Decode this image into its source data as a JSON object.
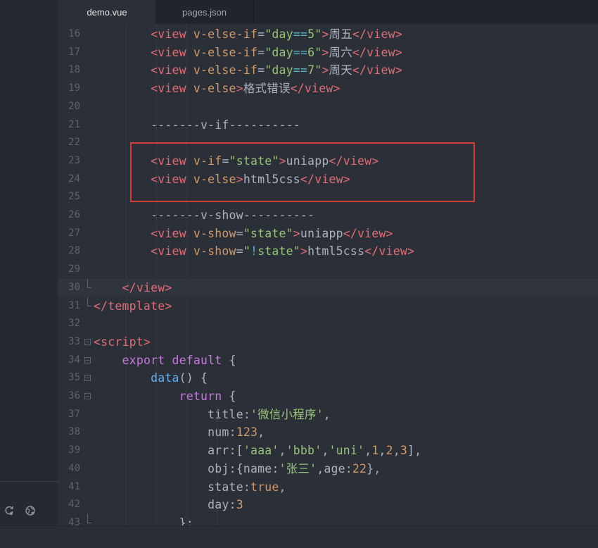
{
  "tabs": [
    {
      "label": "demo.vue",
      "active": true
    },
    {
      "label": "pages.json",
      "active": false
    }
  ],
  "colors": {
    "tag": "#e06c75",
    "attribute": "#d19a66",
    "string": "#98c379",
    "keyword": "#c678dd",
    "function": "#61afef",
    "highlight_box": "#d43c36"
  },
  "sidebar": {
    "icons": [
      "refresh-icon",
      "globe-icon"
    ]
  },
  "editor": {
    "lines": [
      {
        "n": "16",
        "indent": "        ",
        "tokens": [
          [
            "tag",
            "<view "
          ],
          [
            "attr",
            "v-else-if"
          ],
          [
            "pun",
            "="
          ],
          [
            "str",
            "\"day"
          ],
          [
            "op",
            "=="
          ],
          [
            "str",
            "5\""
          ],
          [
            "tag",
            ">"
          ],
          [
            "txt",
            "周五"
          ],
          [
            "tag",
            "</view>"
          ]
        ]
      },
      {
        "n": "17",
        "indent": "        ",
        "tokens": [
          [
            "tag",
            "<view "
          ],
          [
            "attr",
            "v-else-if"
          ],
          [
            "pun",
            "="
          ],
          [
            "str",
            "\"day"
          ],
          [
            "op",
            "=="
          ],
          [
            "str",
            "6\""
          ],
          [
            "tag",
            ">"
          ],
          [
            "txt",
            "周六"
          ],
          [
            "tag",
            "</view>"
          ]
        ]
      },
      {
        "n": "18",
        "indent": "        ",
        "tokens": [
          [
            "tag",
            "<view "
          ],
          [
            "attr",
            "v-else-if"
          ],
          [
            "pun",
            "="
          ],
          [
            "str",
            "\"day"
          ],
          [
            "op",
            "=="
          ],
          [
            "str",
            "7\""
          ],
          [
            "tag",
            ">"
          ],
          [
            "txt",
            "周天"
          ],
          [
            "tag",
            "</view>"
          ]
        ]
      },
      {
        "n": "19",
        "indent": "        ",
        "tokens": [
          [
            "tag",
            "<view "
          ],
          [
            "attr",
            "v-else"
          ],
          [
            "tag",
            ">"
          ],
          [
            "txt",
            "格式错误"
          ],
          [
            "tag",
            "</view>"
          ]
        ]
      },
      {
        "n": "20",
        "indent": "",
        "tokens": []
      },
      {
        "n": "21",
        "indent": "        ",
        "tokens": [
          [
            "txt",
            "-------v-if----------"
          ]
        ]
      },
      {
        "n": "22",
        "indent": "",
        "tokens": []
      },
      {
        "n": "23",
        "indent": "        ",
        "tokens": [
          [
            "tag",
            "<view "
          ],
          [
            "attr",
            "v-if"
          ],
          [
            "pun",
            "="
          ],
          [
            "str",
            "\"state\""
          ],
          [
            "tag",
            ">"
          ],
          [
            "txt",
            "uniapp"
          ],
          [
            "tag",
            "</view>"
          ]
        ]
      },
      {
        "n": "24",
        "indent": "        ",
        "tokens": [
          [
            "tag",
            "<view "
          ],
          [
            "attr",
            "v-else"
          ],
          [
            "tag",
            ">"
          ],
          [
            "txt",
            "html5css"
          ],
          [
            "tag",
            "</view>"
          ]
        ]
      },
      {
        "n": "25",
        "indent": "",
        "tokens": []
      },
      {
        "n": "26",
        "indent": "        ",
        "tokens": [
          [
            "txt",
            "-------v-show----------"
          ]
        ]
      },
      {
        "n": "27",
        "indent": "        ",
        "tokens": [
          [
            "tag",
            "<view "
          ],
          [
            "attr",
            "v-show"
          ],
          [
            "pun",
            "="
          ],
          [
            "str",
            "\"state\""
          ],
          [
            "tag",
            ">"
          ],
          [
            "txt",
            "uniapp"
          ],
          [
            "tag",
            "</view>"
          ]
        ]
      },
      {
        "n": "28",
        "indent": "        ",
        "tokens": [
          [
            "tag",
            "<view "
          ],
          [
            "attr",
            "v-show"
          ],
          [
            "pun",
            "="
          ],
          [
            "str",
            "\""
          ],
          [
            "op",
            "!"
          ],
          [
            "str",
            "state\""
          ],
          [
            "tag",
            ">"
          ],
          [
            "txt",
            "html5css"
          ],
          [
            "tag",
            "</view>"
          ]
        ]
      },
      {
        "n": "29",
        "indent": "",
        "tokens": []
      },
      {
        "n": "30",
        "indent": "    ",
        "tokens": [
          [
            "tag",
            "</view>"
          ]
        ],
        "fold": "end",
        "hl": true
      },
      {
        "n": "31",
        "indent": "",
        "tokens": [
          [
            "tag",
            "</template>"
          ]
        ],
        "fold": "end"
      },
      {
        "n": "32",
        "indent": "",
        "tokens": []
      },
      {
        "n": "33",
        "indent": "",
        "tokens": [
          [
            "tag",
            "<script>"
          ]
        ],
        "fold": "open"
      },
      {
        "n": "34",
        "indent": "    ",
        "tokens": [
          [
            "kw",
            "export"
          ],
          [
            "pun",
            " "
          ],
          [
            "kw",
            "default"
          ],
          [
            "pun",
            " {"
          ]
        ],
        "fold": "open"
      },
      {
        "n": "35",
        "indent": "        ",
        "tokens": [
          [
            "fn",
            "data"
          ],
          [
            "pun",
            "() {"
          ]
        ],
        "fold": "open"
      },
      {
        "n": "36",
        "indent": "            ",
        "tokens": [
          [
            "kw",
            "return"
          ],
          [
            "pun",
            " {"
          ]
        ],
        "fold": "open"
      },
      {
        "n": "37",
        "indent": "                ",
        "tokens": [
          [
            "key",
            "title"
          ],
          [
            "pun",
            ":"
          ],
          [
            "str",
            "'微信小程序'"
          ],
          [
            "pun",
            ","
          ]
        ]
      },
      {
        "n": "38",
        "indent": "                ",
        "tokens": [
          [
            "key",
            "num"
          ],
          [
            "pun",
            ":"
          ],
          [
            "num",
            "123"
          ],
          [
            "pun",
            ","
          ]
        ]
      },
      {
        "n": "39",
        "indent": "                ",
        "tokens": [
          [
            "key",
            "arr"
          ],
          [
            "pun",
            ":["
          ],
          [
            "str",
            "'aaa'"
          ],
          [
            "pun",
            ","
          ],
          [
            "str",
            "'bbb'"
          ],
          [
            "pun",
            ","
          ],
          [
            "str",
            "'uni'"
          ],
          [
            "pun",
            ","
          ],
          [
            "num",
            "1"
          ],
          [
            "pun",
            ","
          ],
          [
            "num",
            "2"
          ],
          [
            "pun",
            ","
          ],
          [
            "num",
            "3"
          ],
          [
            "pun",
            "],"
          ]
        ]
      },
      {
        "n": "40",
        "indent": "                ",
        "tokens": [
          [
            "key",
            "obj"
          ],
          [
            "pun",
            ":{"
          ],
          [
            "key",
            "name"
          ],
          [
            "pun",
            ":"
          ],
          [
            "str",
            "'张三'"
          ],
          [
            "pun",
            ","
          ],
          [
            "key",
            "age"
          ],
          [
            "pun",
            ":"
          ],
          [
            "num",
            "22"
          ],
          [
            "pun",
            "},"
          ]
        ]
      },
      {
        "n": "41",
        "indent": "                ",
        "tokens": [
          [
            "key",
            "state"
          ],
          [
            "pun",
            ":"
          ],
          [
            "num",
            "true"
          ],
          [
            "pun",
            ","
          ]
        ]
      },
      {
        "n": "42",
        "indent": "                ",
        "tokens": [
          [
            "key",
            "day"
          ],
          [
            "pun",
            ":"
          ],
          [
            "num",
            "3"
          ]
        ]
      },
      {
        "n": "43",
        "indent": "            ",
        "tokens": [
          [
            "pun",
            "};"
          ]
        ],
        "fold": "end"
      }
    ]
  }
}
